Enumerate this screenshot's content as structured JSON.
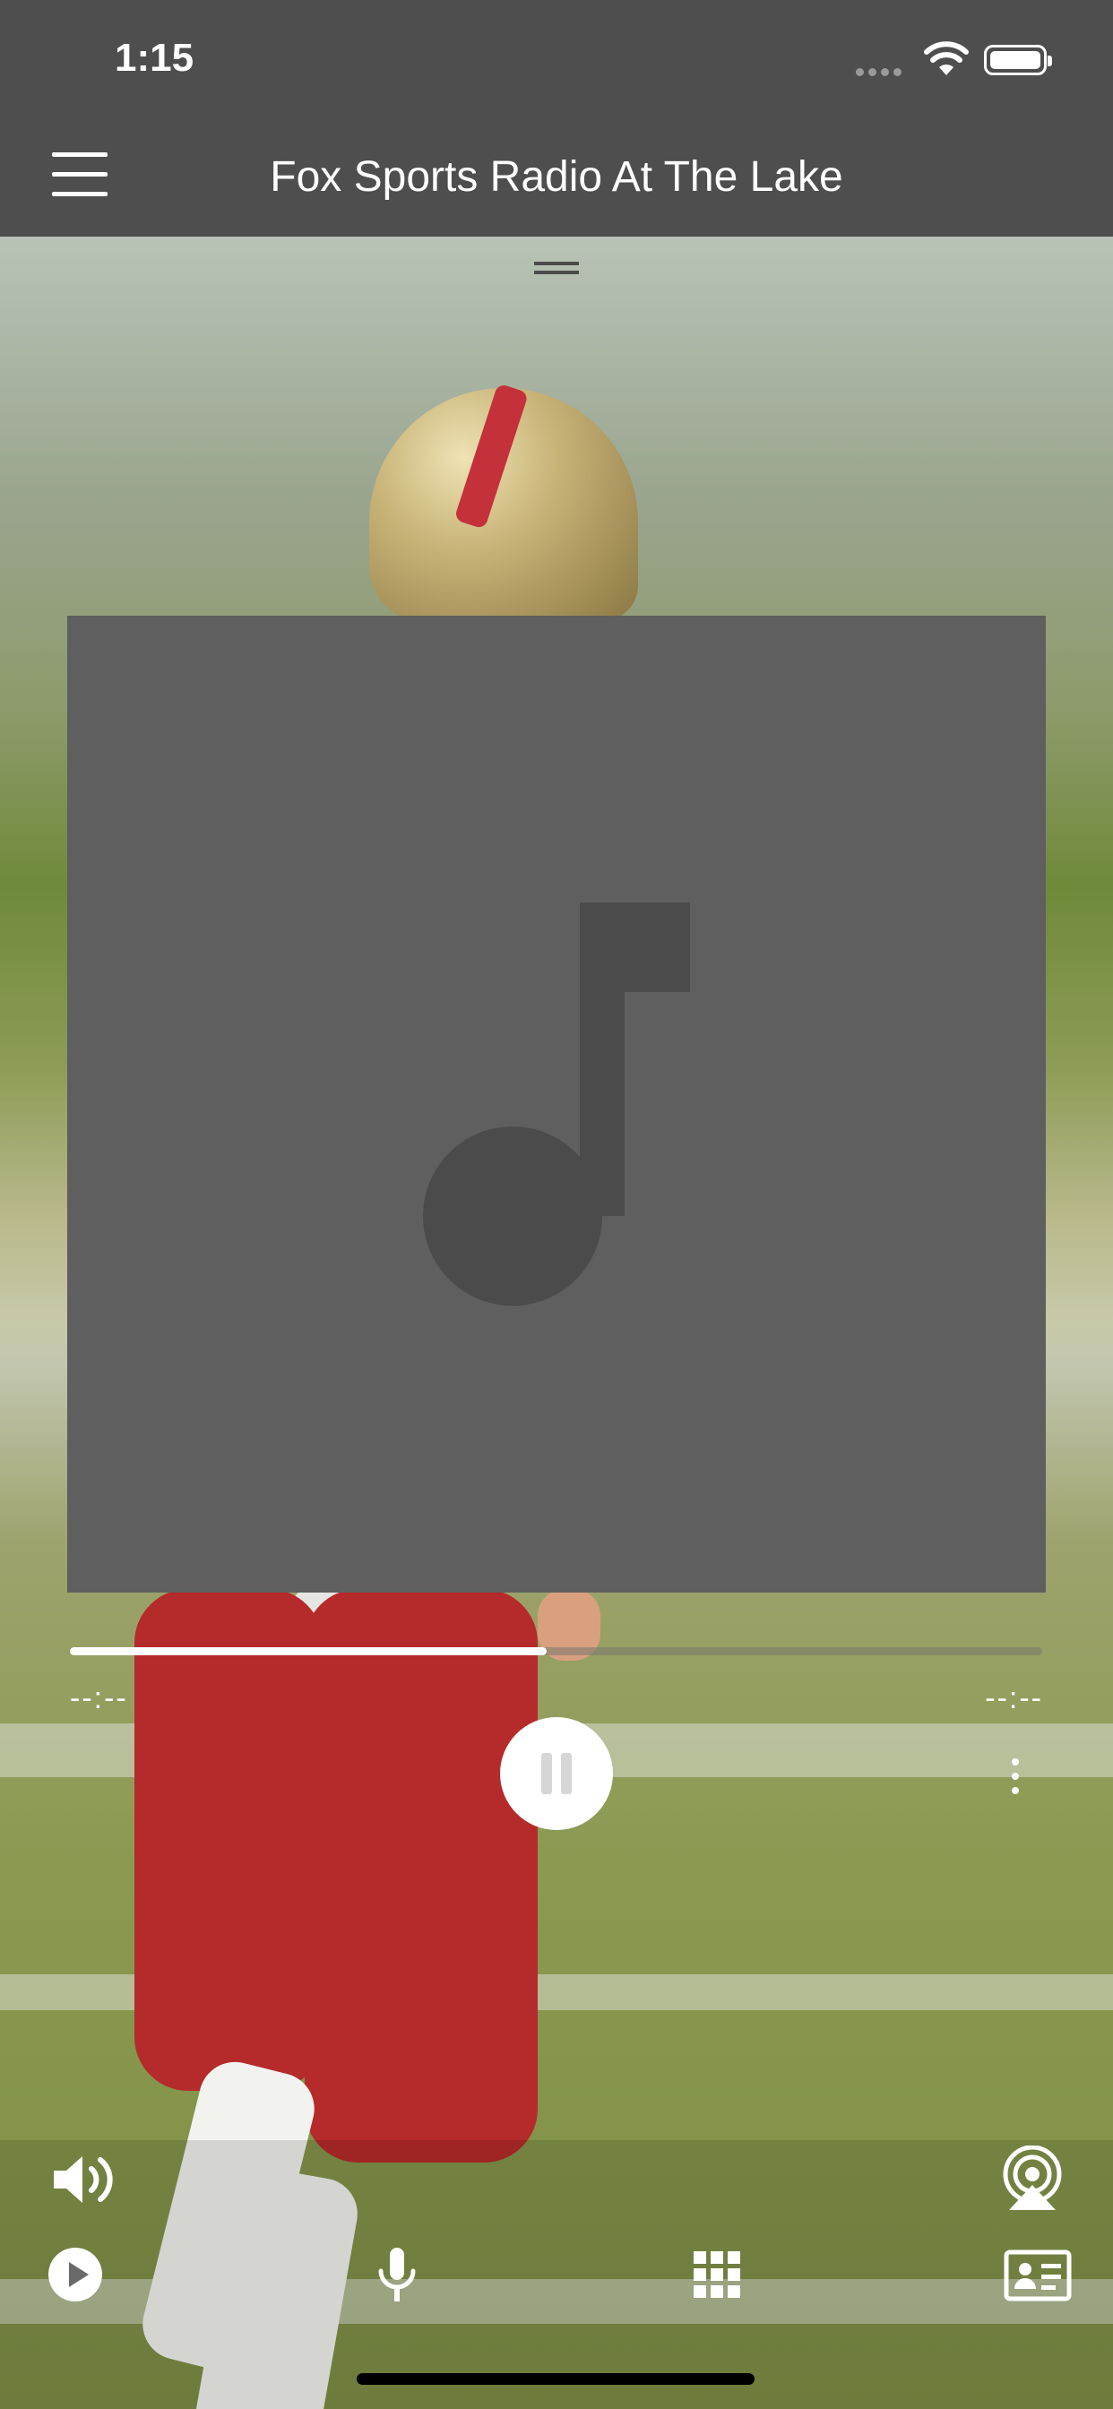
{
  "status_bar": {
    "time": "1:15"
  },
  "header": {
    "title": "Fox Sports Radio At The Lake"
  },
  "player": {
    "time_elapsed": "--:--",
    "time_remaining": "--:--",
    "progress_fraction": 0.49,
    "state": "playing"
  },
  "toolbar": {
    "icons": [
      "volume-icon",
      "airplay-icon",
      "play-circle-icon",
      "microphone-icon",
      "grid-icon",
      "contact-card-icon"
    ]
  },
  "colors": {
    "bar": "#4e4e4e",
    "artwork": "#5f5f5f",
    "note": "#4b4b4b"
  }
}
